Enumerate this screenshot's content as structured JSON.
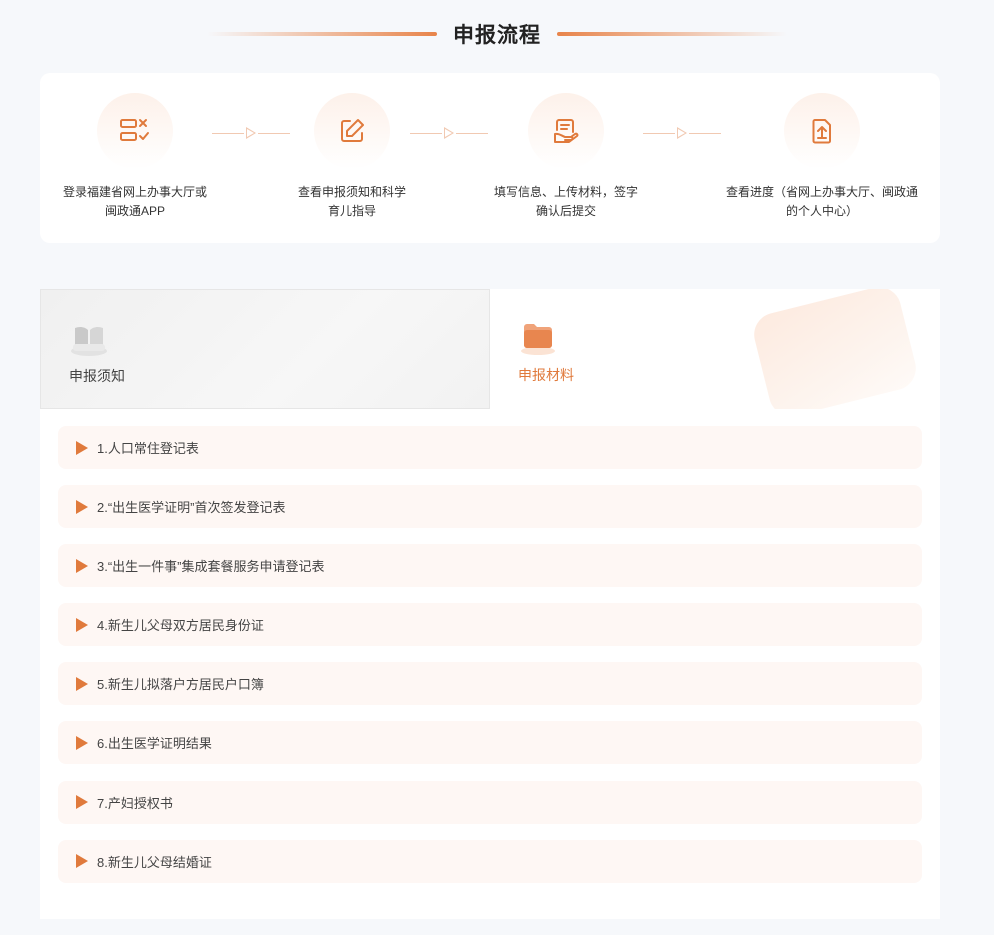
{
  "section_title": "申报流程",
  "steps": [
    {
      "icon": "checklist-icon",
      "text_line1": "登录福建省网上办事大厅或",
      "text_line2": "闽政通APP"
    },
    {
      "icon": "edit-icon",
      "text_line1": "查看申报须知和科学",
      "text_line2": "育儿指导"
    },
    {
      "icon": "sign-hand-icon",
      "text_line1": "填写信息、上传材料，签字",
      "text_line2": "确认后提交"
    },
    {
      "icon": "upload-document-icon",
      "text_line1": "查看进度（省网上办事大厅、闽政通",
      "text_line2": "的个人中心）"
    }
  ],
  "tabs": [
    {
      "label": "申报须知",
      "icon": "book-icon",
      "active": false
    },
    {
      "label": "申报材料",
      "icon": "folder-icon",
      "active": true
    }
  ],
  "materials": [
    "1.人口常住登记表",
    "2.“出生医学证明”首次签发登记表",
    "3.“出生一件事”集成套餐服务申请登记表",
    "4.新生儿父母双方居民身份证",
    "5.新生儿拟落户方居民户口簿",
    "6.出生医学证明结果",
    "7.产妇授权书",
    "8.新生儿父母结婚证"
  ],
  "colors": {
    "accent": "#e07a3c",
    "item_bg": "#fef7f4",
    "page_bg": "#f6f8fb"
  }
}
